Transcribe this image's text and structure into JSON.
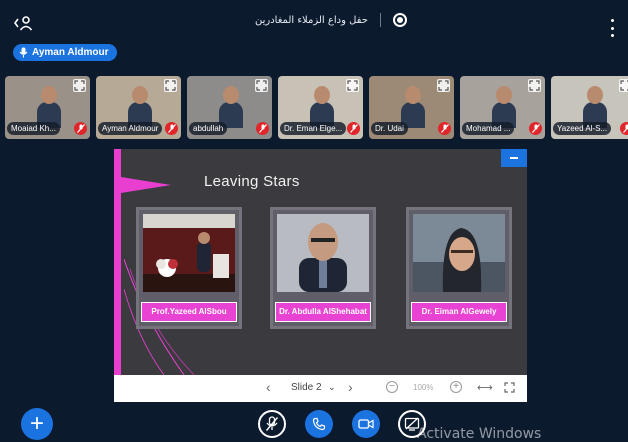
{
  "header": {
    "users_icon": "users-icon",
    "meeting_title": "حفل وداع الزملاء المغادرين",
    "record_icon": "record-icon",
    "more_icon": "more-vertical-icon"
  },
  "talking": {
    "name": "Ayman Aldmour",
    "icon": "mic-icon"
  },
  "participants": [
    {
      "name": "Moaiad Kh...",
      "bg": "#9a9288"
    },
    {
      "name": "Ayman Aldmour",
      "bg": "#b6aa97"
    },
    {
      "name": "abdullah",
      "bg": "#8d8c8a"
    },
    {
      "name": "Dr. Eman Elge...",
      "bg": "#c8c2b6"
    },
    {
      "name": "Dr. Udai",
      "bg": "#9c8a76"
    },
    {
      "name": "Mohamad ...",
      "bg": "#a8a29c"
    },
    {
      "name": "Yazeed Al-S...",
      "bg": "#c7c4bc"
    }
  ],
  "slide": {
    "title": "Leaving Stars",
    "cards": [
      {
        "name": "Prof.Yazeed AlSbou"
      },
      {
        "name": "Dr. Abdulla AlShehabat"
      },
      {
        "name": "Dr. Eiman AlGewely"
      }
    ],
    "nav": {
      "prev": "‹",
      "label": "Slide 2",
      "caret": "⌄",
      "next": "›",
      "zoom_minus": "−",
      "zoom": "100%",
      "zoom_plus": "+",
      "fit_width": "⟷"
    }
  },
  "controls": {
    "add_icon": "plus-icon",
    "add_label": "+"
  },
  "watermark": "Activate Windows",
  "colors": {
    "accent": "#1b73e0",
    "danger": "#e0262b",
    "slide_pink": "#e843d2",
    "background": "#0c1a2e"
  }
}
